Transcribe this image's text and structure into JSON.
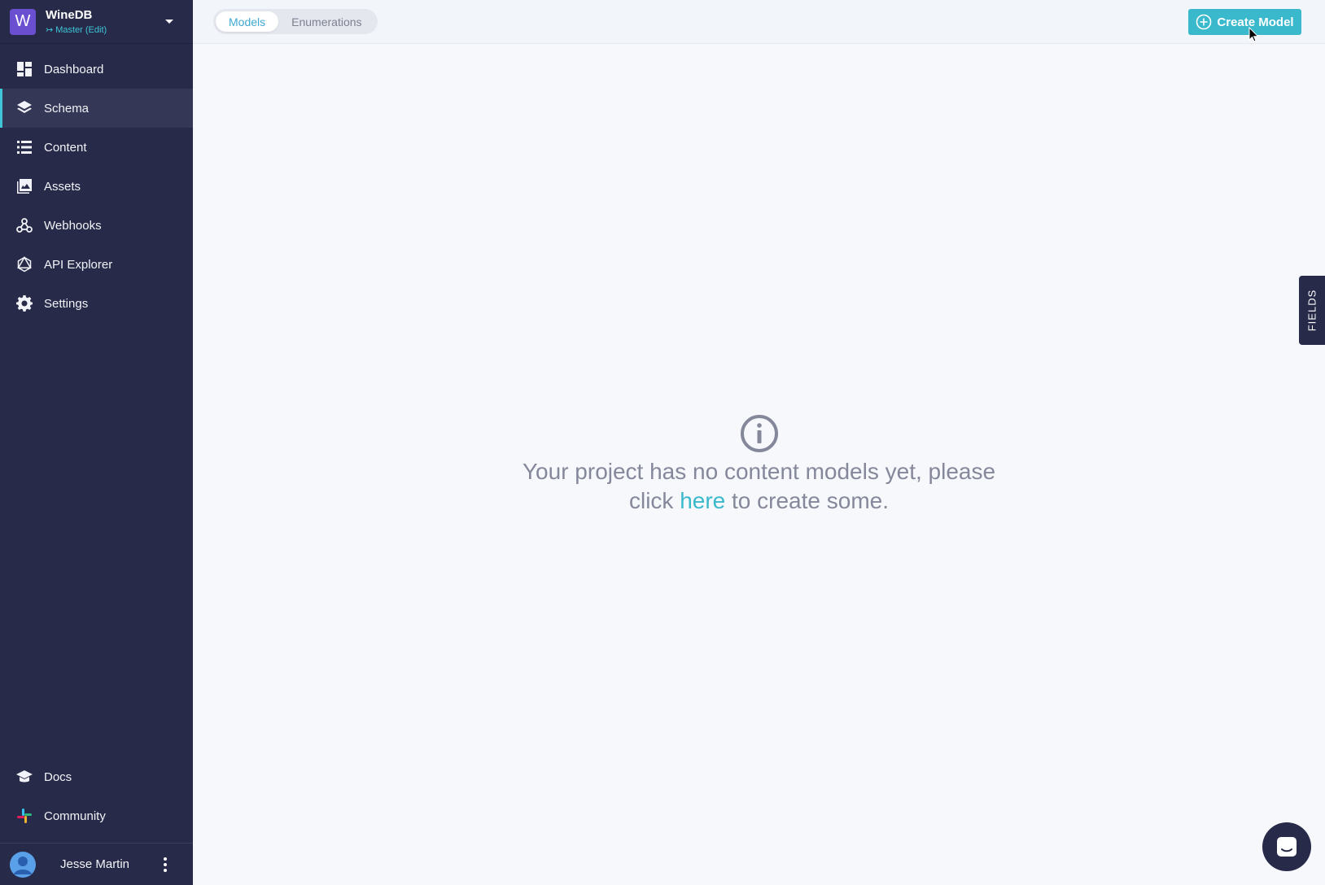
{
  "project": {
    "initial": "W",
    "name": "WineDB",
    "branch": "Master (Edit)"
  },
  "nav": {
    "dashboard": "Dashboard",
    "schema": "Schema",
    "content": "Content",
    "assets": "Assets",
    "webhooks": "Webhooks",
    "api_explorer": "API Explorer",
    "settings": "Settings",
    "docs": "Docs",
    "community": "Community"
  },
  "user": {
    "name": "Jesse Martin"
  },
  "tabs": {
    "models": "Models",
    "enumerations": "Enumerations"
  },
  "actions": {
    "create_model": "Create Model"
  },
  "empty_state": {
    "text_before": "Your project has no content models yet, please click ",
    "link": "here",
    "text_after": " to create some."
  },
  "fields_tab": "FIELDS",
  "colors": {
    "accent": "#3ab9cc",
    "sidebar": "#272a48",
    "project_avatar": "#6a4fd0"
  }
}
